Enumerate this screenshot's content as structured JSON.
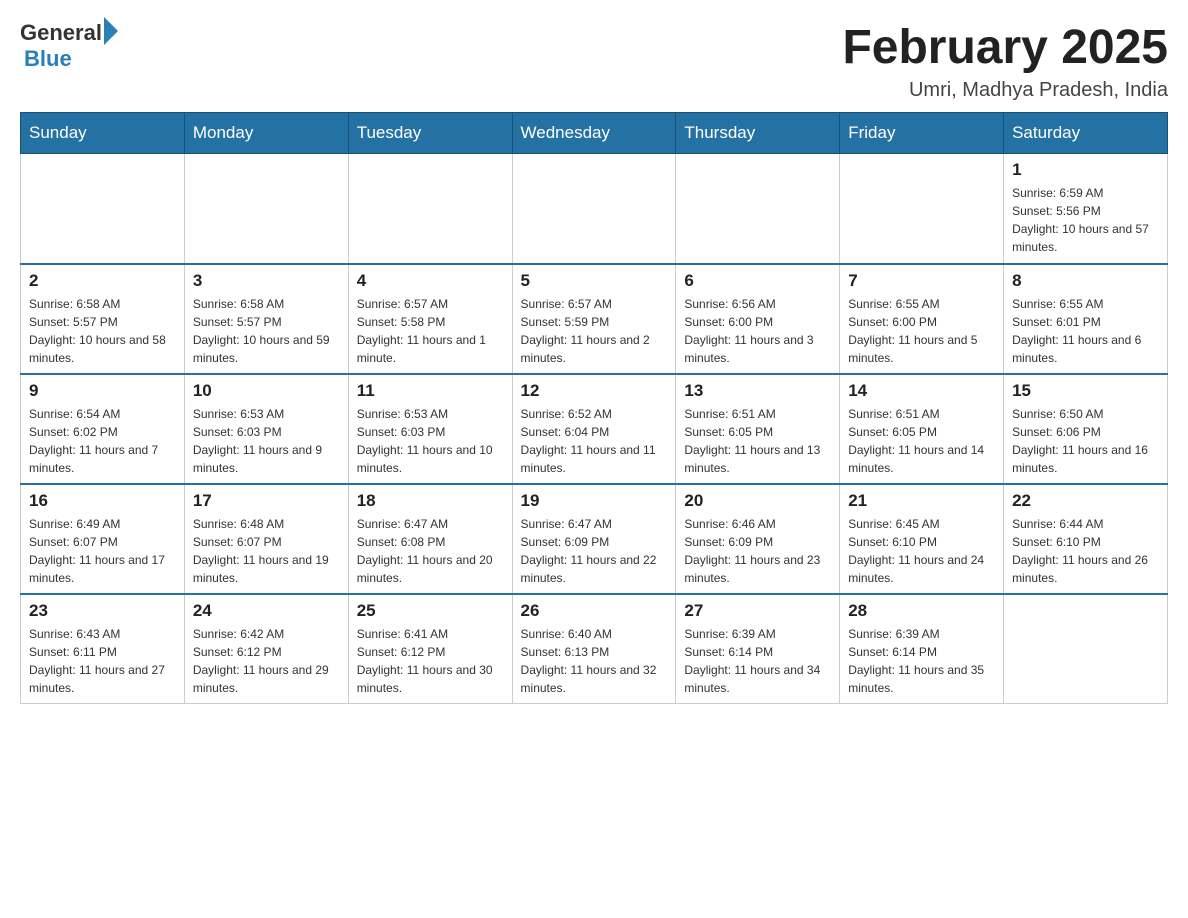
{
  "header": {
    "logo": {
      "general": "General",
      "blue": "Blue"
    },
    "title": "February 2025",
    "location": "Umri, Madhya Pradesh, India"
  },
  "calendar": {
    "weekdays": [
      "Sunday",
      "Monday",
      "Tuesday",
      "Wednesday",
      "Thursday",
      "Friday",
      "Saturday"
    ],
    "weeks": [
      [
        {
          "day": "",
          "info": ""
        },
        {
          "day": "",
          "info": ""
        },
        {
          "day": "",
          "info": ""
        },
        {
          "day": "",
          "info": ""
        },
        {
          "day": "",
          "info": ""
        },
        {
          "day": "",
          "info": ""
        },
        {
          "day": "1",
          "info": "Sunrise: 6:59 AM\nSunset: 5:56 PM\nDaylight: 10 hours and 57 minutes."
        }
      ],
      [
        {
          "day": "2",
          "info": "Sunrise: 6:58 AM\nSunset: 5:57 PM\nDaylight: 10 hours and 58 minutes."
        },
        {
          "day": "3",
          "info": "Sunrise: 6:58 AM\nSunset: 5:57 PM\nDaylight: 10 hours and 59 minutes."
        },
        {
          "day": "4",
          "info": "Sunrise: 6:57 AM\nSunset: 5:58 PM\nDaylight: 11 hours and 1 minute."
        },
        {
          "day": "5",
          "info": "Sunrise: 6:57 AM\nSunset: 5:59 PM\nDaylight: 11 hours and 2 minutes."
        },
        {
          "day": "6",
          "info": "Sunrise: 6:56 AM\nSunset: 6:00 PM\nDaylight: 11 hours and 3 minutes."
        },
        {
          "day": "7",
          "info": "Sunrise: 6:55 AM\nSunset: 6:00 PM\nDaylight: 11 hours and 5 minutes."
        },
        {
          "day": "8",
          "info": "Sunrise: 6:55 AM\nSunset: 6:01 PM\nDaylight: 11 hours and 6 minutes."
        }
      ],
      [
        {
          "day": "9",
          "info": "Sunrise: 6:54 AM\nSunset: 6:02 PM\nDaylight: 11 hours and 7 minutes."
        },
        {
          "day": "10",
          "info": "Sunrise: 6:53 AM\nSunset: 6:03 PM\nDaylight: 11 hours and 9 minutes."
        },
        {
          "day": "11",
          "info": "Sunrise: 6:53 AM\nSunset: 6:03 PM\nDaylight: 11 hours and 10 minutes."
        },
        {
          "day": "12",
          "info": "Sunrise: 6:52 AM\nSunset: 6:04 PM\nDaylight: 11 hours and 11 minutes."
        },
        {
          "day": "13",
          "info": "Sunrise: 6:51 AM\nSunset: 6:05 PM\nDaylight: 11 hours and 13 minutes."
        },
        {
          "day": "14",
          "info": "Sunrise: 6:51 AM\nSunset: 6:05 PM\nDaylight: 11 hours and 14 minutes."
        },
        {
          "day": "15",
          "info": "Sunrise: 6:50 AM\nSunset: 6:06 PM\nDaylight: 11 hours and 16 minutes."
        }
      ],
      [
        {
          "day": "16",
          "info": "Sunrise: 6:49 AM\nSunset: 6:07 PM\nDaylight: 11 hours and 17 minutes."
        },
        {
          "day": "17",
          "info": "Sunrise: 6:48 AM\nSunset: 6:07 PM\nDaylight: 11 hours and 19 minutes."
        },
        {
          "day": "18",
          "info": "Sunrise: 6:47 AM\nSunset: 6:08 PM\nDaylight: 11 hours and 20 minutes."
        },
        {
          "day": "19",
          "info": "Sunrise: 6:47 AM\nSunset: 6:09 PM\nDaylight: 11 hours and 22 minutes."
        },
        {
          "day": "20",
          "info": "Sunrise: 6:46 AM\nSunset: 6:09 PM\nDaylight: 11 hours and 23 minutes."
        },
        {
          "day": "21",
          "info": "Sunrise: 6:45 AM\nSunset: 6:10 PM\nDaylight: 11 hours and 24 minutes."
        },
        {
          "day": "22",
          "info": "Sunrise: 6:44 AM\nSunset: 6:10 PM\nDaylight: 11 hours and 26 minutes."
        }
      ],
      [
        {
          "day": "23",
          "info": "Sunrise: 6:43 AM\nSunset: 6:11 PM\nDaylight: 11 hours and 27 minutes."
        },
        {
          "day": "24",
          "info": "Sunrise: 6:42 AM\nSunset: 6:12 PM\nDaylight: 11 hours and 29 minutes."
        },
        {
          "day": "25",
          "info": "Sunrise: 6:41 AM\nSunset: 6:12 PM\nDaylight: 11 hours and 30 minutes."
        },
        {
          "day": "26",
          "info": "Sunrise: 6:40 AM\nSunset: 6:13 PM\nDaylight: 11 hours and 32 minutes."
        },
        {
          "day": "27",
          "info": "Sunrise: 6:39 AM\nSunset: 6:14 PM\nDaylight: 11 hours and 34 minutes."
        },
        {
          "day": "28",
          "info": "Sunrise: 6:39 AM\nSunset: 6:14 PM\nDaylight: 11 hours and 35 minutes."
        },
        {
          "day": "",
          "info": ""
        }
      ]
    ]
  }
}
